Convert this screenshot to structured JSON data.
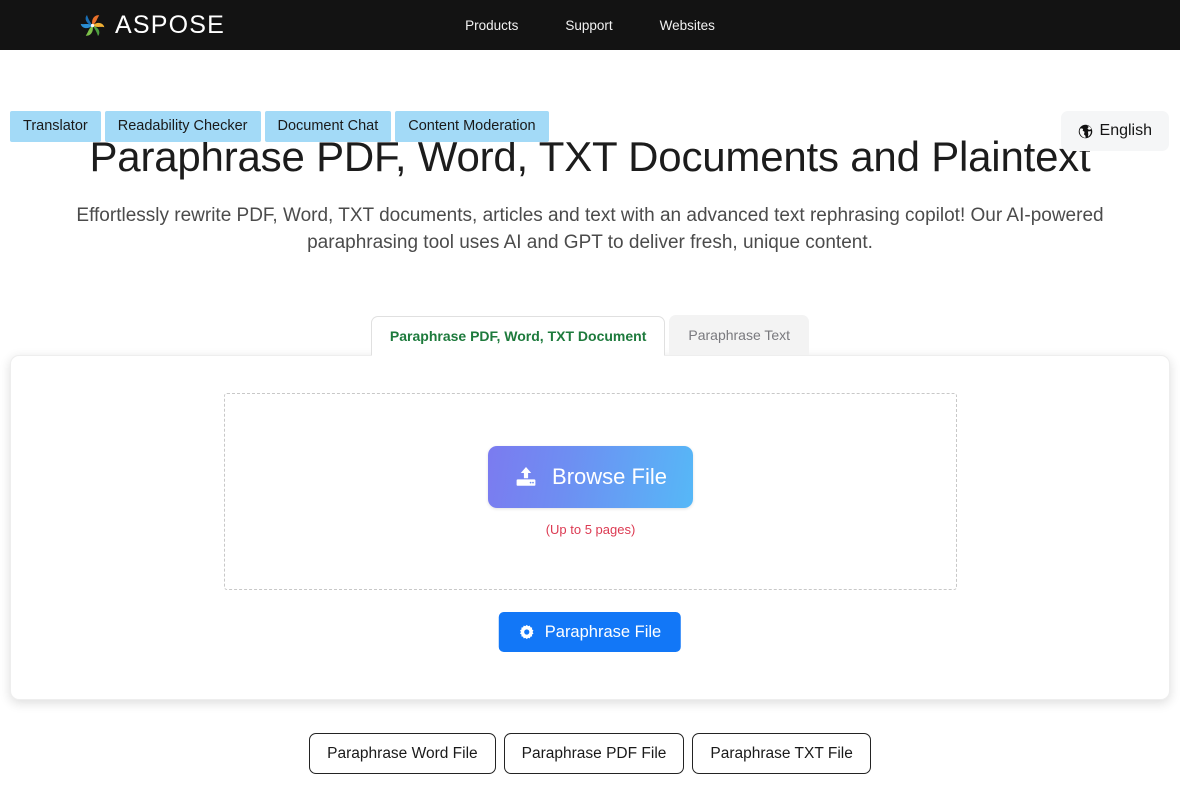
{
  "header": {
    "brand_name": "ASPOSE",
    "logo_icon": "aspose-spiral-logo",
    "nav": [
      {
        "label": "Products"
      },
      {
        "label": "Support"
      },
      {
        "label": "Websites"
      }
    ]
  },
  "tool_pills": [
    {
      "label": "Translator"
    },
    {
      "label": "Readability Checker"
    },
    {
      "label": "Document Chat"
    },
    {
      "label": "Content Moderation"
    }
  ],
  "language": {
    "label": "English",
    "icon": "globe-icon"
  },
  "hero": {
    "title": "Paraphrase PDF, Word, TXT Documents and Plaintext",
    "subtitle": "Effortlessly rewrite PDF, Word, TXT documents, articles and text with an advanced text rephrasing copilot! Our AI-powered paraphrasing tool uses AI and GPT to deliver fresh, unique content."
  },
  "tabs": [
    {
      "label": "Paraphrase PDF, Word, TXT Document",
      "active": true
    },
    {
      "label": "Paraphrase Text",
      "active": false
    }
  ],
  "upload": {
    "browse_label": "Browse File",
    "browse_icon": "file-upload-icon",
    "hint": "(Up to 5 pages)",
    "submit_label": "Paraphrase File",
    "submit_icon": "gear-icon"
  },
  "bottom_buttons": [
    {
      "label": "Paraphrase Word File"
    },
    {
      "label": "Paraphrase PDF File"
    },
    {
      "label": "Paraphrase TXT File"
    }
  ],
  "colors": {
    "topbar_bg": "#131313",
    "pill_bg": "#a3daf7",
    "active_tab_text": "#1d7a3c",
    "hint_text": "#dc3a52",
    "primary_button": "#1277f7",
    "browse_gradient_start": "#7b7bf0",
    "browse_gradient_end": "#56b8f7"
  }
}
